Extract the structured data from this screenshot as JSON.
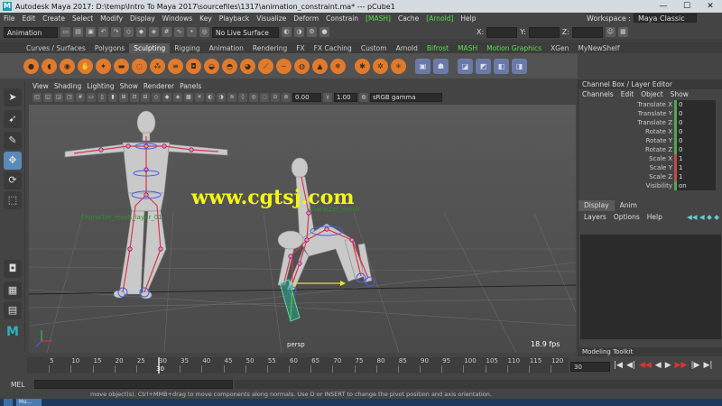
{
  "window": {
    "title": "Autodesk Maya 2017: D:\\temp\\Intro To Maya 2017\\sourcefiles\\1317\\animation_constraint.ma*    ---    pCube1",
    "minimize": "—",
    "maximize": "☐",
    "close": "✕"
  },
  "menubar": {
    "items": [
      "File",
      "Edit",
      "Create",
      "Select",
      "Modify",
      "Display",
      "Windows",
      "Key",
      "Playback",
      "Visualize",
      "Deform",
      "Constrain"
    ],
    "mash": "[MASH]",
    "cache": "Cache",
    "arnold": "[Arnold]",
    "help": "Help",
    "workspace_label": "Workspace :",
    "workspace_value": "Maya Classic"
  },
  "statusline": {
    "mode": "Animation",
    "live_surface": "No Live Surface",
    "x": "X:",
    "y": "Y:",
    "z": "Z:"
  },
  "shelf_tabs": [
    "Curves / Surfaces",
    "Polygons",
    "Sculpting",
    "Rigging",
    "Animation",
    "Rendering",
    "FX",
    "FX Caching",
    "Custom",
    "Arnold",
    "Bifrost",
    "MASH",
    "Motion Graphics",
    "XGen",
    "MyNewShelf"
  ],
  "shelf_active": "Sculpting",
  "viewport": {
    "menu": [
      "View",
      "Shading",
      "Lighting",
      "Show",
      "Renderer",
      "Panels"
    ],
    "field_a": "0.00",
    "field_b": "1.00",
    "color_space": "sRGB gamma",
    "watermark": "www.cgtsj.com",
    "label_1": "character_mesh_layer_01",
    "label_2": "character_mesh",
    "camera": "persp",
    "fps": "18.9 fps"
  },
  "channelbox": {
    "header": "Channel Box / Layer Editor",
    "menu": [
      "Channels",
      "Edit",
      "Object",
      "Show"
    ],
    "attributes": [
      {
        "name": "Translate X",
        "value": "0",
        "color": "green"
      },
      {
        "name": "Translate Y",
        "value": "0",
        "color": "green"
      },
      {
        "name": "Translate Z",
        "value": "0",
        "color": "green"
      },
      {
        "name": "Rotate X",
        "value": "0",
        "color": "green"
      },
      {
        "name": "Rotate Y",
        "value": "0",
        "color": "green"
      },
      {
        "name": "Rotate Z",
        "value": "0",
        "color": "green"
      },
      {
        "name": "Scale X",
        "value": "1",
        "color": "red"
      },
      {
        "name": "Scale Y",
        "value": "1",
        "color": "red"
      },
      {
        "name": "Scale Z",
        "value": "1",
        "color": "red"
      },
      {
        "name": "Visibility",
        "value": "on",
        "color": "green"
      }
    ],
    "layer_tabs": [
      "Display",
      "Anim"
    ],
    "layer_menu": [
      "Layers",
      "Options",
      "Help"
    ]
  },
  "modeling_toolkit": "Modeling Toolkit",
  "timeline": {
    "ticks": [
      "5",
      "10",
      "15",
      "20",
      "25",
      "30",
      "35",
      "40",
      "45",
      "50",
      "55",
      "60",
      "65",
      "70",
      "75",
      "80",
      "85",
      "90",
      "95",
      "100",
      "105",
      "110",
      "115",
      "120"
    ],
    "current": "30",
    "current_frame_field": "30",
    "controls": [
      "|◀",
      "◀|",
      "◀◀",
      "◀",
      "▶",
      "▶▶",
      "|▶",
      "▶|"
    ]
  },
  "mel": {
    "label": "MEL",
    "help": "move object(s). Ctrl+MMB+drag to move components along normals. Use D or INSERT to change the pivot position and axis orientation."
  },
  "taskbar": {
    "item": "Hu..."
  }
}
